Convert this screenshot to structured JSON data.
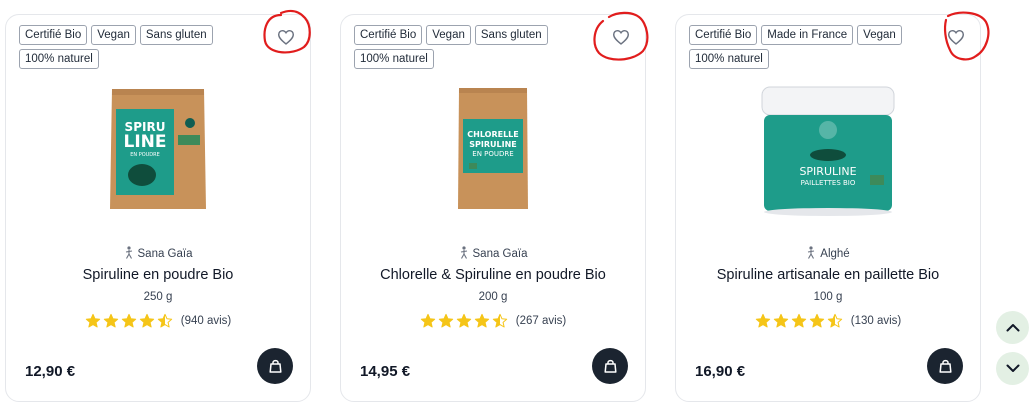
{
  "products": [
    {
      "tags": [
        "Certifié Bio",
        "Vegan",
        "Sans gluten",
        "100% naturel"
      ],
      "brand": "Sana Gaïa",
      "title": "Spiruline en poudre Bio",
      "weight": "250 g",
      "rating": 4.5,
      "reviews": "(940 avis)",
      "price": "12,90 €",
      "package_text": [
        "SPIRU",
        "LINE",
        "EN POUDRE"
      ]
    },
    {
      "tags": [
        "Certifié Bio",
        "Vegan",
        "Sans gluten",
        "100% naturel"
      ],
      "brand": "Sana Gaïa",
      "title": "Chlorelle & Spiruline en poudre Bio",
      "weight": "200 g",
      "rating": 4.5,
      "reviews": "(267 avis)",
      "price": "14,95 €",
      "package_text": [
        "CHLORELLE",
        "SPIRULINE",
        "EN POUDRE"
      ]
    },
    {
      "tags": [
        "Certifié Bio",
        "Made in France",
        "Vegan",
        "100% naturel"
      ],
      "brand": "Alghé",
      "title": "Spiruline artisanale en paillette Bio",
      "weight": "100 g",
      "rating": 4.5,
      "reviews": "(130 avis)",
      "price": "16,90 €",
      "package_text": [
        "SPIRULINE",
        "PAILLETTES BIO"
      ]
    }
  ],
  "colors": {
    "star": "#f5c518",
    "bag_button": "#1b2430",
    "annotation": "#e11d1d",
    "scroll_button": "#e3f0e4",
    "package_teal": "#1e9c8a",
    "package_kraft": "#c8925a"
  },
  "icons": {
    "favorite": "heart-outline-icon",
    "cart": "shopping-bag-icon",
    "brand": "person-icon",
    "scroll_up": "chevron-up-icon",
    "scroll_down": "chevron-down-icon"
  }
}
